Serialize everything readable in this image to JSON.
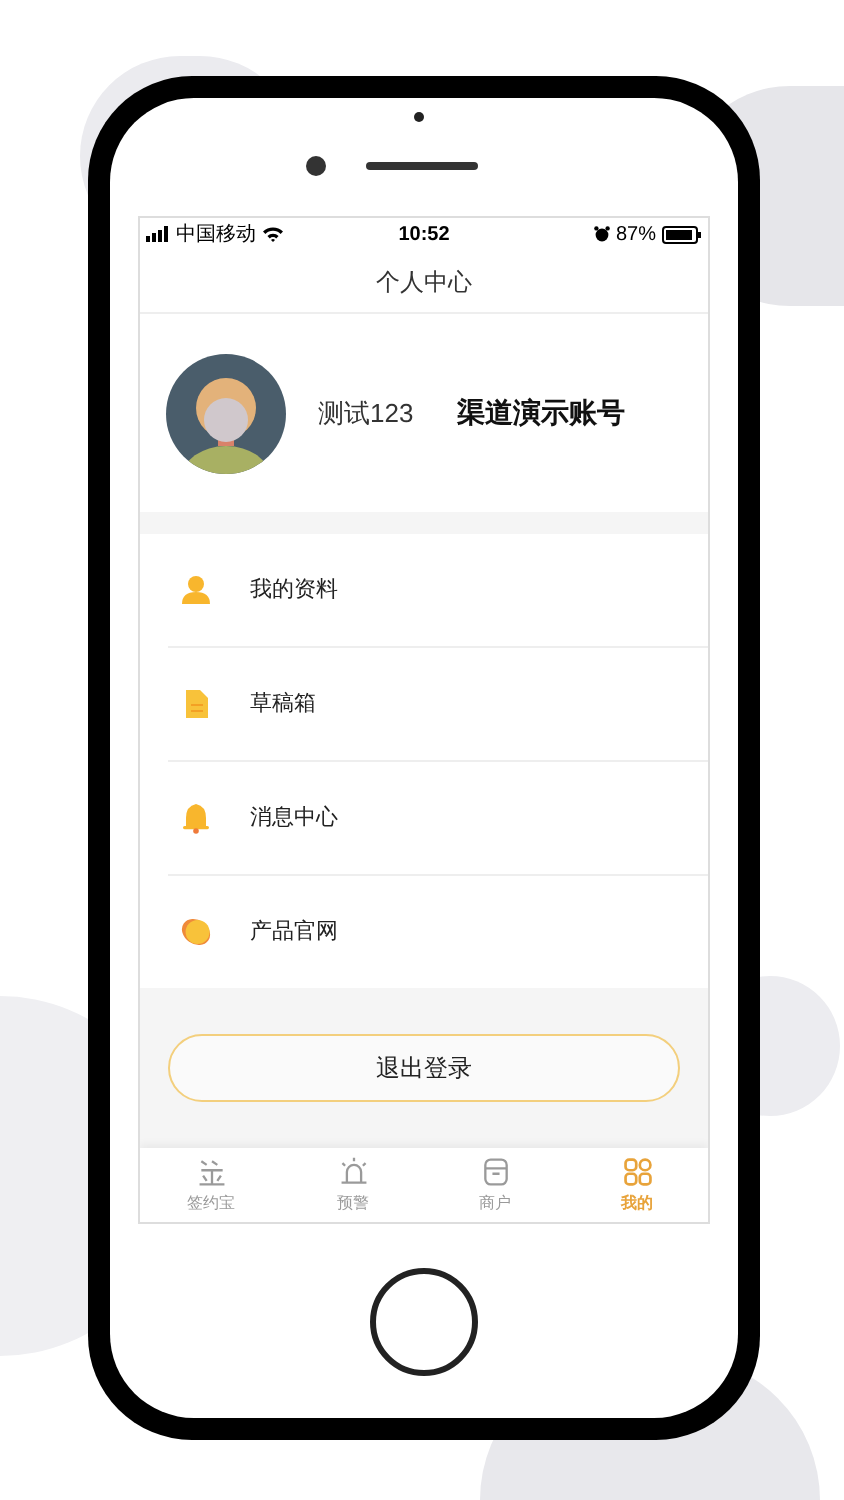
{
  "status_bar": {
    "carrier": "中国移动",
    "time": "10:52",
    "battery": "87%"
  },
  "nav_title": "个人中心",
  "profile": {
    "name": "测试123",
    "account": "渠道演示账号"
  },
  "menu": [
    {
      "kind": "profile",
      "label": "我的资料"
    },
    {
      "kind": "drafts",
      "label": "草稿箱"
    },
    {
      "kind": "messages",
      "label": "消息中心"
    },
    {
      "kind": "website",
      "label": "产品官网"
    }
  ],
  "logout_button": "退出登录",
  "tabs": [
    {
      "kind": "sign",
      "label": "签约宝",
      "selected": false
    },
    {
      "kind": "alert",
      "label": "预警",
      "selected": false
    },
    {
      "kind": "merchant",
      "label": "商户",
      "selected": false
    },
    {
      "kind": "mine",
      "label": "我的",
      "selected": true
    }
  ]
}
